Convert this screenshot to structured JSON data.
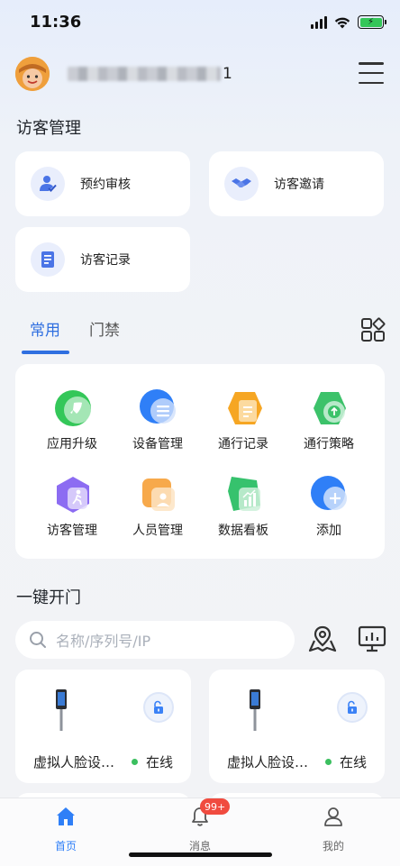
{
  "status_bar": {
    "time": "11:36",
    "battery_charging": true,
    "battery_color": "#35c759"
  },
  "header": {
    "username_visible_suffix": "1",
    "menu_icon": "hamburger-menu-icon"
  },
  "visitor_management": {
    "title": "访客管理",
    "items": [
      {
        "label": "预约审核",
        "icon": "appointment-review-icon"
      },
      {
        "label": "访客邀请",
        "icon": "handshake-icon"
      },
      {
        "label": "访客记录",
        "icon": "document-icon"
      }
    ]
  },
  "tabs": {
    "items": [
      {
        "label": "常用",
        "active": true
      },
      {
        "label": "门禁",
        "active": false
      }
    ],
    "accent_color": "#2f6fe0"
  },
  "apps": [
    {
      "label": "应用升级",
      "icon": "rocket-icon",
      "color": "#34c759"
    },
    {
      "label": "设备管理",
      "icon": "device-list-icon",
      "color": "#2f7ff7"
    },
    {
      "label": "通行记录",
      "icon": "record-icon",
      "color": "#f6a623"
    },
    {
      "label": "通行策略",
      "icon": "upload-icon",
      "color": "#3cc26a"
    },
    {
      "label": "访客管理",
      "icon": "walking-person-icon",
      "color": "#8c6cf2"
    },
    {
      "label": "人员管理",
      "icon": "person-card-icon",
      "color": "#f7a94b"
    },
    {
      "label": "数据看板",
      "icon": "chart-board-icon",
      "color": "#36c26d"
    },
    {
      "label": "添加",
      "icon": "plus-icon",
      "color": "#2f7ff7"
    }
  ],
  "one_key_open": {
    "title": "一键开门",
    "search": {
      "placeholder": "名称/序列号/IP"
    },
    "devices": [
      {
        "name": "虚拟人脸设…",
        "status": "在线"
      },
      {
        "name": "虚拟人脸设…",
        "status": "在线"
      }
    ]
  },
  "bottom_nav": {
    "items": [
      {
        "label": "首页",
        "icon": "home-icon",
        "active": true
      },
      {
        "label": "消息",
        "icon": "bell-icon",
        "active": false,
        "badge": "99+"
      },
      {
        "label": "我的",
        "icon": "user-icon",
        "active": false
      }
    ]
  }
}
